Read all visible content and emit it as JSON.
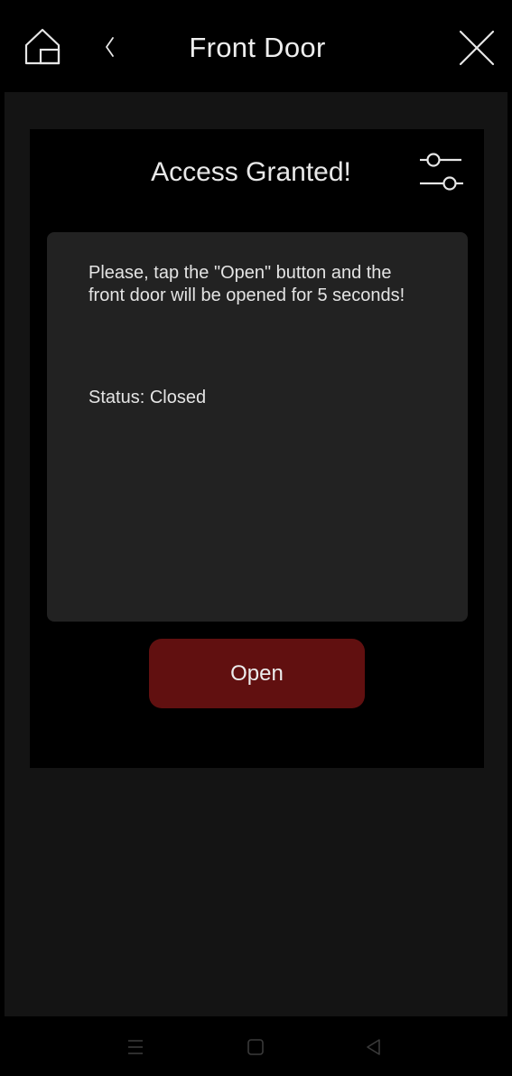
{
  "header": {
    "title": "Front Door",
    "icons": {
      "home": "home-icon",
      "back": "chevron-left-icon",
      "close": "close-icon"
    }
  },
  "card": {
    "title": "Access Granted!",
    "settings_icon": "sliders-icon",
    "message": "Please, tap the \"Open\" button and the front door will be opened for 5 seconds!",
    "status": "Status: Closed",
    "open_button": "Open"
  },
  "navbar": {
    "icons": [
      "menu-icon",
      "home-square-icon",
      "back-triangle-icon"
    ]
  },
  "colors": {
    "background": "#141414",
    "bars": "#000000",
    "panel": "#222222",
    "button": "#611010",
    "text": "#e6e6e6"
  }
}
